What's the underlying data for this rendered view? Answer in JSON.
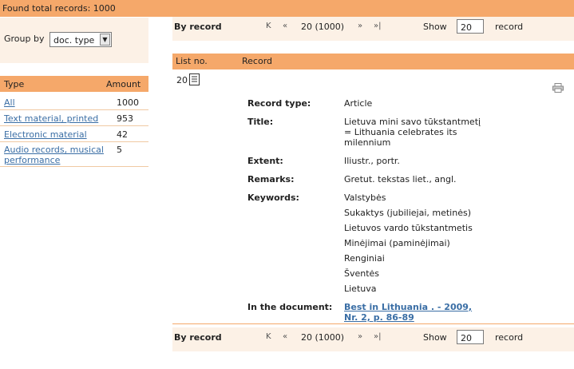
{
  "summary": {
    "found_total": "Found total records: 1000"
  },
  "group_by": {
    "label": "Group by",
    "selected": "doc. type"
  },
  "type_table": {
    "headers": {
      "type": "Type",
      "amount": "Amount"
    },
    "rows": [
      {
        "type": "All",
        "amount": "1000"
      },
      {
        "type": "Text material, printed",
        "amount": "953"
      },
      {
        "type": "Electronic material",
        "amount": "42"
      },
      {
        "type": "Audio records, musical",
        "type2": "performance",
        "amount": "5"
      }
    ]
  },
  "nav": {
    "by_record": "By record",
    "first": "K",
    "prev": "«",
    "page_text": "20 (1000)",
    "next": "»",
    "last": "»|",
    "show_label": "Show",
    "show_value": "20",
    "record_label": "record"
  },
  "record_table": {
    "headers": {
      "list_no": "List no.",
      "record": "Record"
    }
  },
  "record": {
    "number": "20",
    "fields": {
      "type_label": "Record type:",
      "type_value": "Article",
      "title_label": "Title:",
      "title_lines": [
        "Lietuva mini savo tūkstantmetį",
        "= Lithuania celebrates its",
        "milennium"
      ],
      "extent_label": "Extent:",
      "extent_value": "Iliustr., portr.",
      "remarks_label": "Remarks:",
      "remarks_value": "Gretut. tekstas liet., angl.",
      "keywords_label": "Keywords:",
      "keywords": [
        "Valstybės",
        "Sukaktys (jubiliejai, metinės)",
        "Lietuvos vardo tūkstantmetis",
        "Minėjimai (paminėjimai)",
        "Renginiai",
        "Šventės",
        "Lietuva"
      ],
      "document_label": "In the document:",
      "document_lines": [
        "Best in Lithuania . - 2009,",
        "Nr. 2, p. 86-89"
      ]
    }
  }
}
